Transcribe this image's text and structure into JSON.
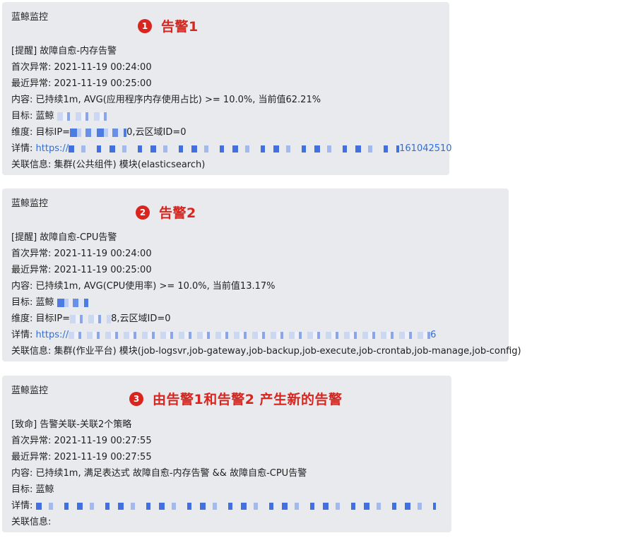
{
  "alerts": [
    {
      "sender": "蓝鲸监控",
      "badge_number": "1",
      "badge_title": "告警1",
      "subject": "[提醒] 故障自愈-内存告警",
      "first_label": "首次异常: ",
      "first_time": "2021-11-19 00:24:00",
      "last_label": "最近异常: ",
      "last_time": "2021-11-19 00:25:00",
      "content": "内容: 已持续1m, AVG(应用程序内存使用占比) >= 10.0%, 当前值62.21%",
      "target_label": "目标: 蓝鲸",
      "target_tail": "",
      "dimension_label": "维度: 目标IP=",
      "dimension_tail": "0,云区域ID=0",
      "detail_label": "详情: ",
      "detail_link_head": "https://",
      "detail_link_tail": "161042510",
      "related": "关联信息: 集群(公共组件) 模块(elasticsearch)"
    },
    {
      "sender": "蓝鲸监控",
      "badge_number": "2",
      "badge_title": "告警2",
      "subject": "[提醒] 故障自愈-CPU告警",
      "first_label": "首次异常: ",
      "first_time": "2021-11-19 00:24:00",
      "last_label": "最近异常: ",
      "last_time": "2021-11-19 00:25:00",
      "content": "内容: 已持续1m, AVG(CPU使用率) >= 10.0%, 当前值13.17%",
      "target_label": "目标: 蓝鲸",
      "target_tail": "",
      "dimension_label": "维度: 目标IP=",
      "dimension_tail": "8,云区域ID=0",
      "detail_label": "详情: ",
      "detail_link_head": "https://",
      "detail_link_tail": "6",
      "related": "关联信息: 集群(作业平台) 模块(job-logsvr,job-gateway,job-backup,job-execute,job-crontab,job-manage,job-config)"
    },
    {
      "sender": "蓝鲸监控",
      "badge_number": "3",
      "badge_title": "由告警1和告警2 产生新的告警",
      "subject": "[致命] 告警关联-关联2个策略",
      "first_label": "首次异常: ",
      "first_time": "2021-11-19 00:27:55",
      "last_label": "最近异常: ",
      "last_time": "2021-11-19 00:27:55",
      "content": "内容: 已持续1m, 满足表达式 故障自愈-内存告警 && 故障自愈-CPU告警",
      "target_label": "目标: 蓝鲸",
      "detail_label": "详情: ",
      "related": "关联信息:"
    }
  ],
  "colors": {
    "card_bg": "#e9eaee",
    "badge_red": "#d9251d",
    "link_blue": "#2f6fd6"
  }
}
